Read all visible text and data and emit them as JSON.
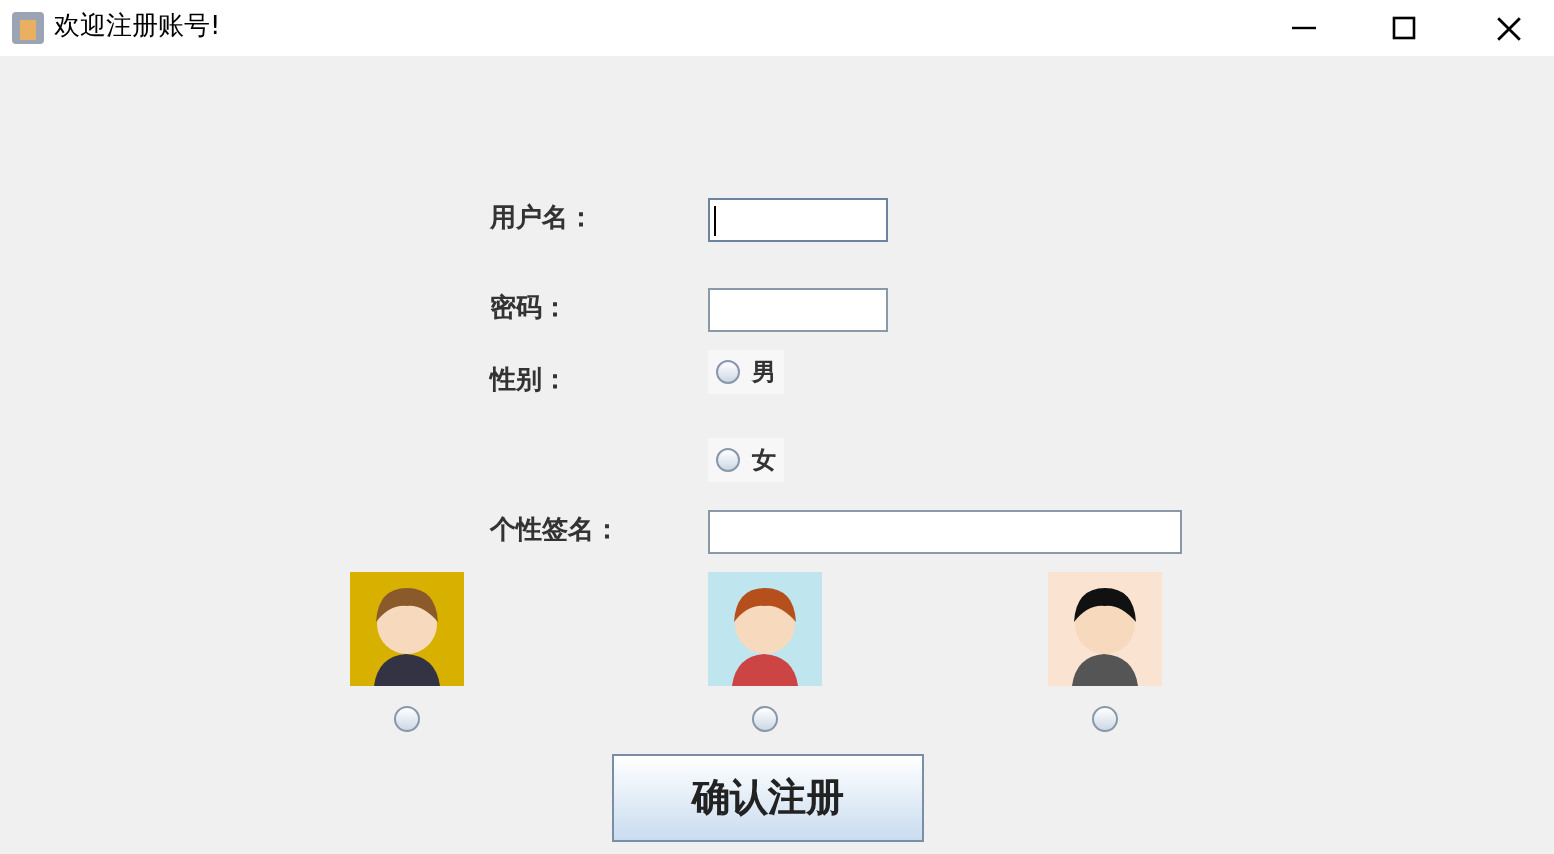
{
  "window": {
    "title": "欢迎注册账号!"
  },
  "fields": [
    {
      "label": "用户名：",
      "focused": true
    },
    {
      "label": "密码：",
      "focused": false
    }
  ],
  "gender": {
    "label": "性别：",
    "options": [
      {
        "label": "男",
        "selected": false
      },
      {
        "label": "女",
        "selected": false
      }
    ]
  },
  "signature": {
    "label": "个性签名：",
    "focused": false
  },
  "submit_button": {
    "label": "确认注册"
  }
}
